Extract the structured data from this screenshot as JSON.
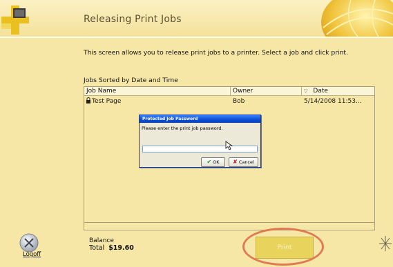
{
  "header": {
    "title": "Releasing Print Jobs"
  },
  "intro_text": "This screen allows you to release print jobs to a printer. Select a job and click print.",
  "jobs_list": {
    "caption": "Jobs Sorted by Date and Time",
    "columns": [
      "Job Name",
      "Owner",
      "Date"
    ],
    "rows": [
      {
        "name": "Test Page",
        "owner": "Bob",
        "date": "5/14/2008 11:53..."
      }
    ]
  },
  "dialog": {
    "title": "Protected Job Password",
    "prompt": "Please enter the print job password.",
    "password_value": "",
    "ok_label": "OK",
    "cancel_label": "Cancel"
  },
  "footer": {
    "logoff_label": "Logoff",
    "balance_label": "Balance",
    "total_label": "Total",
    "total_value": "$19.60",
    "print_label": "Print"
  },
  "colors": {
    "background": "#f6e7a6",
    "dialog_title": "#0a4fd6",
    "print_button": "#e8d35c",
    "highlight": "#e07a52"
  },
  "icons": [
    "logo-cube-icon",
    "globe-icon",
    "lock-icon",
    "sort-arrow-icon",
    "cursor-icon",
    "checkmark-icon",
    "x-icon",
    "logoff-icon",
    "corner-icon"
  ]
}
